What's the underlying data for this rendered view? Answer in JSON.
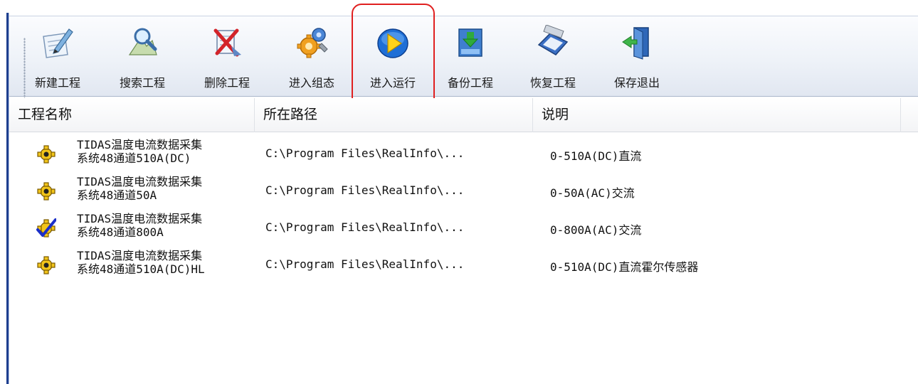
{
  "toolbar": {
    "buttons": [
      {
        "id": "new",
        "label": "新建工程",
        "icon": "new-project-icon"
      },
      {
        "id": "search",
        "label": "搜索工程",
        "icon": "search-project-icon"
      },
      {
        "id": "delete",
        "label": "删除工程",
        "icon": "delete-project-icon"
      },
      {
        "id": "config",
        "label": "进入组态",
        "icon": "configure-gear-icon"
      },
      {
        "id": "run",
        "label": "进入运行",
        "icon": "run-play-icon"
      },
      {
        "id": "backup",
        "label": "备份工程",
        "icon": "backup-download-icon"
      },
      {
        "id": "restore",
        "label": "恢复工程",
        "icon": "restore-icon"
      },
      {
        "id": "save_exit",
        "label": "保存退出",
        "icon": "save-exit-door-icon"
      }
    ],
    "highlighted": "run",
    "highlight_color": "#e02020"
  },
  "list": {
    "columns": [
      "工程名称",
      "所在路径",
      "说明"
    ],
    "rows": [
      {
        "name_line1": "TIDAS温度电流数据采集",
        "name_line2": "系统48通道510A(DC)",
        "path": "C:\\Program Files\\RealInfo\\...",
        "desc": "0-510A(DC)直流",
        "icon": "project-gear-icon",
        "active": false
      },
      {
        "name_line1": "TIDAS温度电流数据采集",
        "name_line2": "系统48通道50A",
        "path": "C:\\Program Files\\RealInfo\\...",
        "desc": "0-50A(AC)交流",
        "icon": "project-gear-icon",
        "active": false
      },
      {
        "name_line1": "TIDAS温度电流数据采集",
        "name_line2": "系统48通道800A",
        "path": "C:\\Program Files\\RealInfo\\...",
        "desc": "0-800A(AC)交流",
        "icon": "project-gear-checked-icon",
        "active": true
      },
      {
        "name_line1": "TIDAS温度电流数据采集",
        "name_line2": "系统48通道510A(DC)HL",
        "path": "C:\\Program Files\\RealInfo\\...",
        "desc": "0-510A(DC)直流霍尔传感器",
        "icon": "project-gear-icon",
        "active": false
      }
    ]
  }
}
